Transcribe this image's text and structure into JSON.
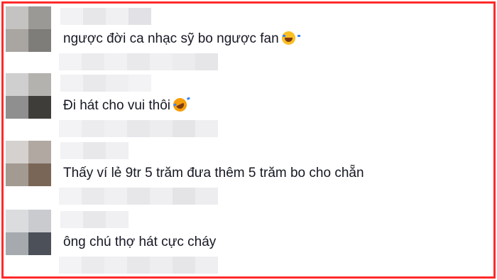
{
  "comments": [
    {
      "text": "ngược đời ca nhạc sỹ bo ngược fan",
      "emoji": "face-with-tears-of-joy"
    },
    {
      "text": "Đi hát cho vui thôi",
      "emoji": "rolling-on-the-floor-laughing"
    },
    {
      "text": "Thấy ví lẻ 9tr 5 trăm đưa thêm 5 trăm bo cho chẵn",
      "emoji": ""
    },
    {
      "text": "ông chú thợ hát cực cháy",
      "emoji": ""
    }
  ],
  "colors": {
    "border": "#ff2a2a",
    "text": "#161823",
    "blur_light": "#ececef",
    "blur_mid": "#dcdcdf"
  }
}
